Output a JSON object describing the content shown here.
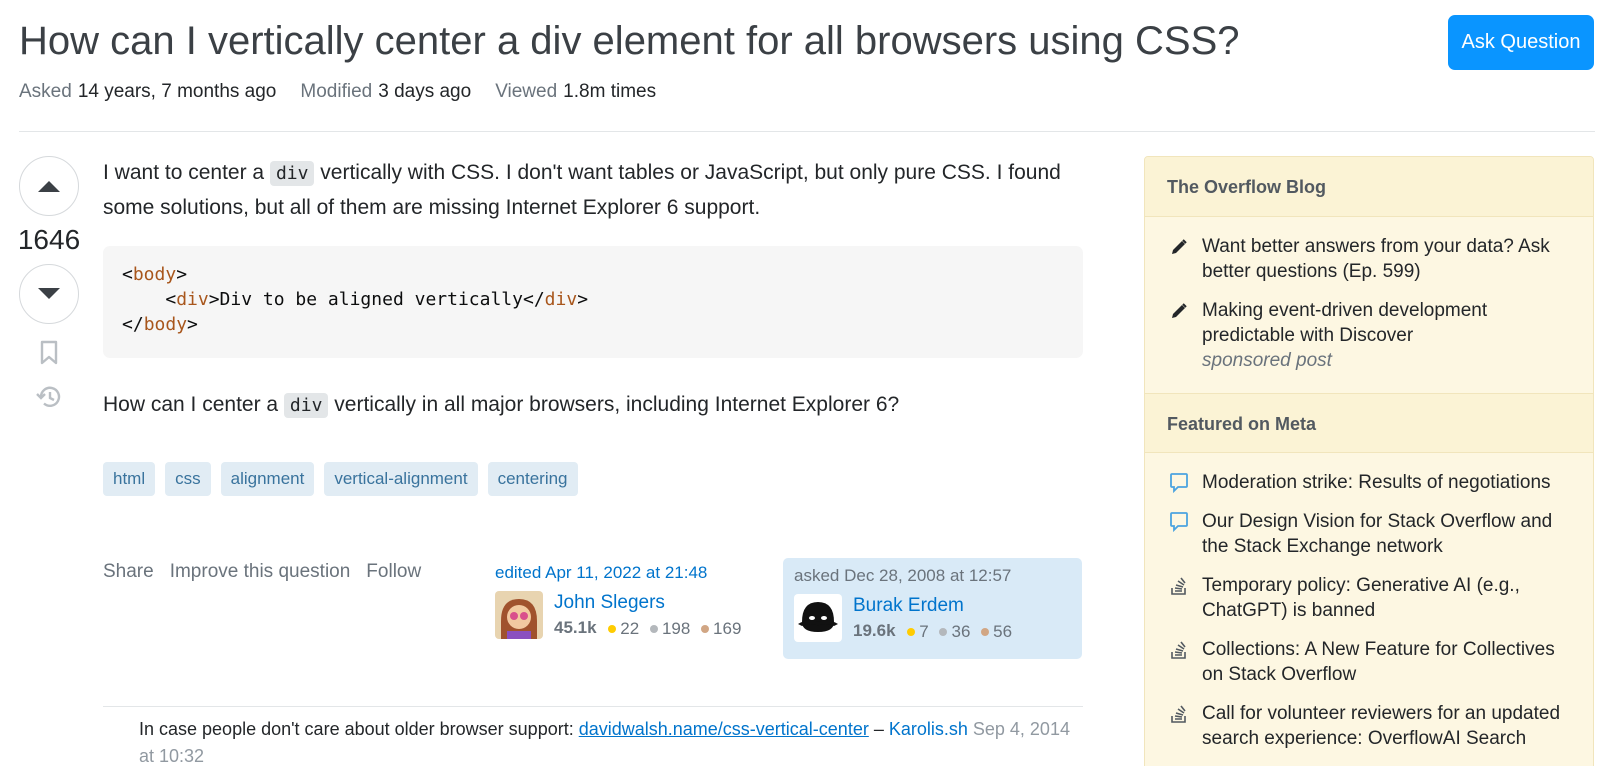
{
  "question": {
    "title": "How can I vertically center a div element for all browsers using CSS?",
    "asked_label": "Asked",
    "asked_value": "14 years, 7 months ago",
    "modified_label": "Modified",
    "modified_value": "3 days ago",
    "viewed_label": "Viewed",
    "viewed_value": "1.8m times",
    "vote_count": "1646",
    "body_1_before": "I want to center a ",
    "body_1_code": "div",
    "body_1_after": " vertically with CSS. I don't want tables or JavaScript, but only pure CSS. I found some solutions, but all of them are missing Internet Explorer 6 support.",
    "code_lines": [
      "<body>",
      "    <div>Div to be aligned vertically</div>",
      "</body>"
    ],
    "code_tags": {
      "body": "body",
      "div": "div"
    },
    "code_inner_text": "Div to be aligned vertically",
    "body_2_before": "How can I center a ",
    "body_2_code": "div",
    "body_2_after": " vertically in all major browsers, including Internet Explorer 6?",
    "tags": [
      "html",
      "css",
      "alignment",
      "vertical-alignment",
      "centering"
    ]
  },
  "header": {
    "ask_button": "Ask Question"
  },
  "actions": {
    "share": "Share",
    "improve": "Improve this question",
    "follow": "Follow"
  },
  "editor": {
    "time": "edited Apr 11, 2022 at 21:48",
    "name": "John Slegers",
    "rep": "45.1k",
    "gold": "22",
    "silver": "198",
    "bronze": "169"
  },
  "owner": {
    "time": "asked Dec 28, 2008 at 12:57",
    "name": "Burak Erdem",
    "rep": "19.6k",
    "gold": "7",
    "silver": "36",
    "bronze": "56"
  },
  "comment": {
    "text": "In case people don't care about older browser support: ",
    "link": "davidwalsh.name/css-vertical-center",
    "sep": " – ",
    "user": "Karolis.sh",
    "date": " Sep 4, 2014 at 10:32"
  },
  "sidebar": {
    "blog_title": "The Overflow Blog",
    "blog_items": [
      "Want better answers from your data? Ask better questions (Ep. 599)",
      "Making event-driven development predictable with Discover"
    ],
    "sponsored": "sponsored post",
    "meta_title": "Featured on Meta",
    "meta_items": [
      "Moderation strike: Results of negotiations",
      "Our Design Vision for Stack Overflow and the Stack Exchange network",
      "Temporary policy: Generative AI (e.g., ChatGPT) is banned",
      "Collections: A New Feature for Collectives on Stack Overflow",
      "Call for volunteer reviewers for an updated search experience: OverflowAI Search"
    ]
  },
  "colors": {
    "accent": "#0a95ff",
    "link": "#0074cc",
    "tag_bg": "#e1ecf4",
    "sidebar_bg": "#fdf7e2"
  },
  "icons": {
    "upvote": "triangle-up-icon",
    "downvote": "triangle-down-icon",
    "bookmark": "bookmark-icon",
    "history": "history-icon",
    "pencil": "pencil-icon",
    "chat": "chat-bubble-icon",
    "stack": "stack-overflow-icon"
  }
}
